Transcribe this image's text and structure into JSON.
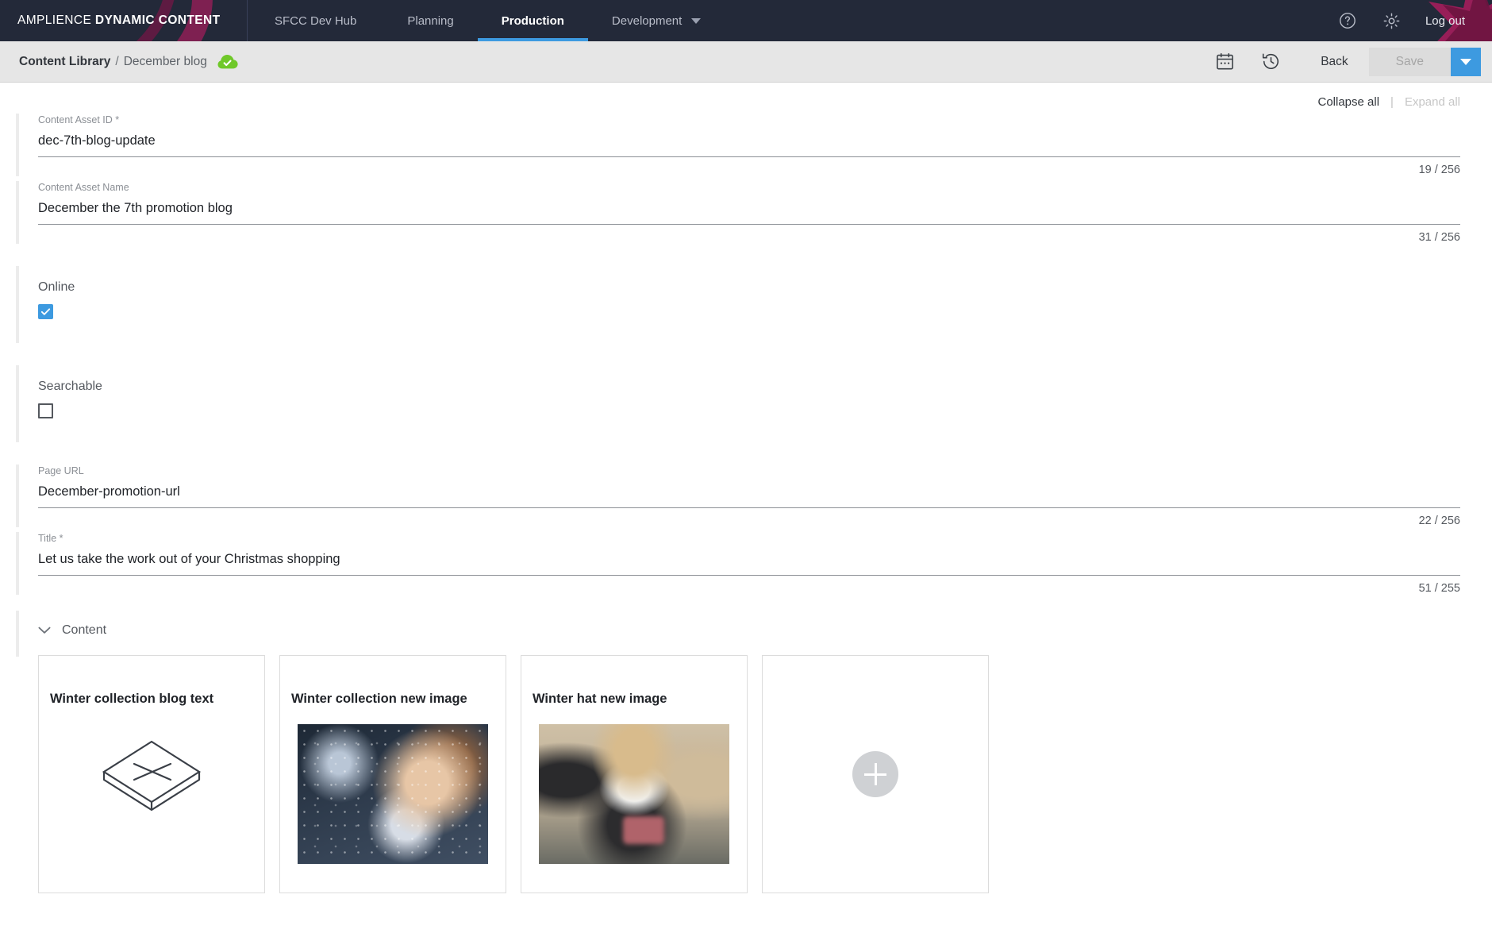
{
  "topnav": {
    "brand_light": "AMPLIENCE ",
    "brand_bold": "DYNAMIC CONTENT",
    "hub": "SFCC Dev Hub",
    "items": [
      {
        "label": "Planning",
        "active": false
      },
      {
        "label": "Production",
        "active": true
      },
      {
        "label": "Development",
        "active": false
      }
    ],
    "help_icon": "help-circle-icon",
    "settings_icon": "gear-icon",
    "logout": "Log out",
    "accent_color": "#3d9ae0",
    "bar_color": "#232939"
  },
  "breadcrumb": {
    "root": "Content Library",
    "separator": "/",
    "current": "December blog",
    "status_icon": "cloud-check-icon",
    "status_color": "#6fc829"
  },
  "toolbar": {
    "calendar_icon": "calendar-icon",
    "history_icon": "history-clock-icon",
    "back_label": "Back",
    "save_label": "Save",
    "save_disabled": true,
    "dropdown_icon": "chevron-down-icon"
  },
  "form_actions": {
    "collapse_all": "Collapse all",
    "divider": "|",
    "expand_all": "Expand all"
  },
  "fields": [
    {
      "label": "Content Asset ID *",
      "value": "dec-7th-blog-update",
      "counter": "19 / 256"
    },
    {
      "label": "Content Asset Name",
      "value": "December the 7th promotion blog",
      "counter": "31 / 256"
    },
    {
      "label": "Page URL",
      "value": "December-promotion-url",
      "counter": "22 / 256"
    },
    {
      "label": "Title *",
      "value": "Let us take the work out of your Christmas shopping",
      "counter": "51 / 255"
    }
  ],
  "checkboxes": [
    {
      "label": "Online",
      "checked": true
    },
    {
      "label": "Searchable",
      "checked": false
    }
  ],
  "content_section": {
    "toggle_icon": "chevron-down-icon",
    "title": "Content",
    "cards": [
      {
        "title": "Winter collection blog text",
        "media": "slab-icon"
      },
      {
        "title": "Winter collection new image",
        "media": "photo-winter"
      },
      {
        "title": "Winter hat new image",
        "media": "photo-hat"
      },
      {
        "title": "",
        "media": "add-button"
      }
    ],
    "add_card_icon": "plus-circle-icon"
  }
}
